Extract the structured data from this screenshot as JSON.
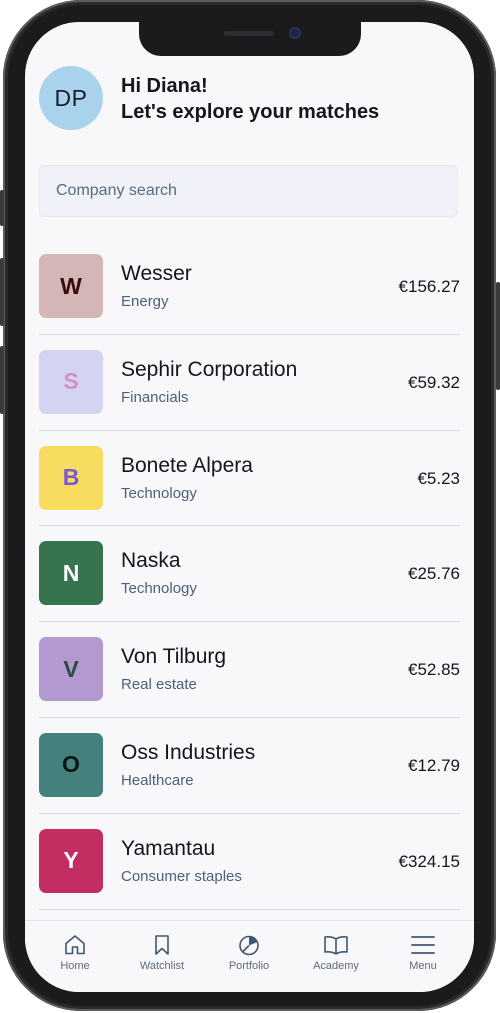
{
  "header": {
    "avatar_initials": "DP",
    "greeting_line1": "Hi Diana!",
    "greeting_line2": "Let's explore your matches"
  },
  "search": {
    "placeholder": "Company search"
  },
  "companies": [
    {
      "initial": "W",
      "name": "Wesser",
      "sector": "Energy",
      "price": "€156.27",
      "logo_bg": "#d5b6b6",
      "logo_fg": "#3a0b0b"
    },
    {
      "initial": "S",
      "name": "Sephir Corporation",
      "sector": "Financials",
      "price": "€59.32",
      "logo_bg": "#d4d3f1",
      "logo_fg": "#d48fc7"
    },
    {
      "initial": "B",
      "name": "Bonete Alpera",
      "sector": "Technology",
      "price": "€5.23",
      "logo_bg": "#f7dc5f",
      "logo_fg": "#7b58d6"
    },
    {
      "initial": "N",
      "name": "Naska",
      "sector": "Technology",
      "price": "€25.76",
      "logo_bg": "#36734f",
      "logo_fg": "#ffffff"
    },
    {
      "initial": "V",
      "name": "Von Tilburg",
      "sector": "Real estate",
      "price": "€52.85",
      "logo_bg": "#b29ad0",
      "logo_fg": "#2e4a45"
    },
    {
      "initial": "O",
      "name": "Oss Industries",
      "sector": "Healthcare",
      "price": "€12.79",
      "logo_bg": "#44807c",
      "logo_fg": "#0c1414"
    },
    {
      "initial": "Y",
      "name": "Yamantau",
      "sector": "Consumer staples",
      "price": "€324.15",
      "logo_bg": "#c22d62",
      "logo_fg": "#ffffff"
    }
  ],
  "nav": {
    "home": {
      "label": "Home",
      "icon": "home-icon"
    },
    "watchlist": {
      "label": "Watchlist",
      "icon": "bookmark-icon"
    },
    "portfolio": {
      "label": "Portfolio",
      "icon": "pie-chart-icon"
    },
    "academy": {
      "label": "Academy",
      "icon": "book-icon"
    },
    "menu": {
      "label": "Menu",
      "icon": "hamburger-menu-icon"
    }
  },
  "colors": {
    "icon_stroke": "#405774",
    "label": "#5a6b80"
  }
}
